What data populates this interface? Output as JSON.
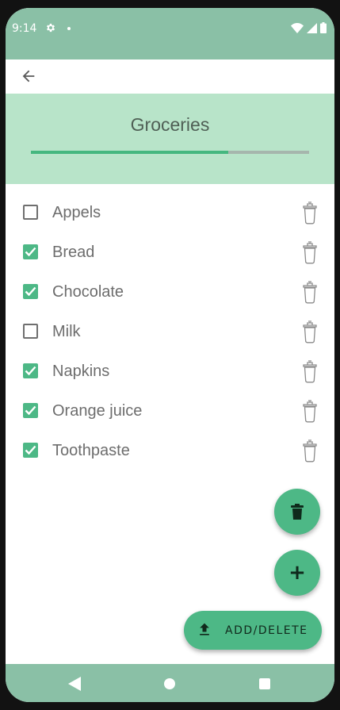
{
  "status_bar": {
    "time": "9:14"
  },
  "header": {
    "title": "Groceries",
    "progress": 0.71
  },
  "items": [
    {
      "label": "Appels",
      "checked": false
    },
    {
      "label": "Bread",
      "checked": true
    },
    {
      "label": "Chocolate",
      "checked": true
    },
    {
      "label": "Milk",
      "checked": false
    },
    {
      "label": "Napkins",
      "checked": true
    },
    {
      "label": "Orange juice",
      "checked": true
    },
    {
      "label": "Toothpaste",
      "checked": true
    }
  ],
  "fab": {
    "add_symbol": "+",
    "add_delete_label": "ADD/DELETE"
  },
  "colors": {
    "accent": "#4db886",
    "header_bg": "#b8e4c9",
    "status_bar_bg": "#8ac0a6"
  }
}
